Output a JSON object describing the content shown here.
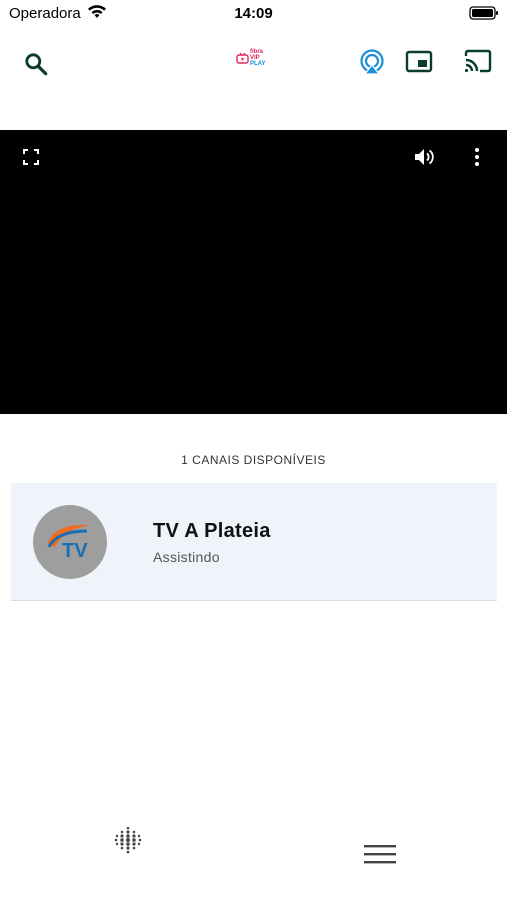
{
  "status_bar": {
    "carrier": "Operadora",
    "time": "14:09"
  },
  "app_bar": {
    "logo_lines": [
      "fibra",
      "VIP",
      "PLAY"
    ],
    "icons": [
      "search-icon",
      "airplay-icon",
      "picture-in-picture-icon",
      "cast-icon"
    ]
  },
  "player": {
    "icons": [
      "fullscreen-icon",
      "volume-icon",
      "more-vertical-icon"
    ]
  },
  "channels": {
    "count_label": "1 CANAIS DISPONÍVEIS",
    "items": [
      {
        "name": "TV A Plateia",
        "status": "Assistindo",
        "logo_text": "TV"
      }
    ]
  },
  "bottom_nav": {
    "icons": [
      "keypad-icon",
      "menu-icon"
    ]
  },
  "colors": {
    "icon_dark_green": "#0b3d2e",
    "airplay_blue": "#1a8fd6",
    "card_background": "#eef4fa",
    "player_background": "#000000"
  }
}
